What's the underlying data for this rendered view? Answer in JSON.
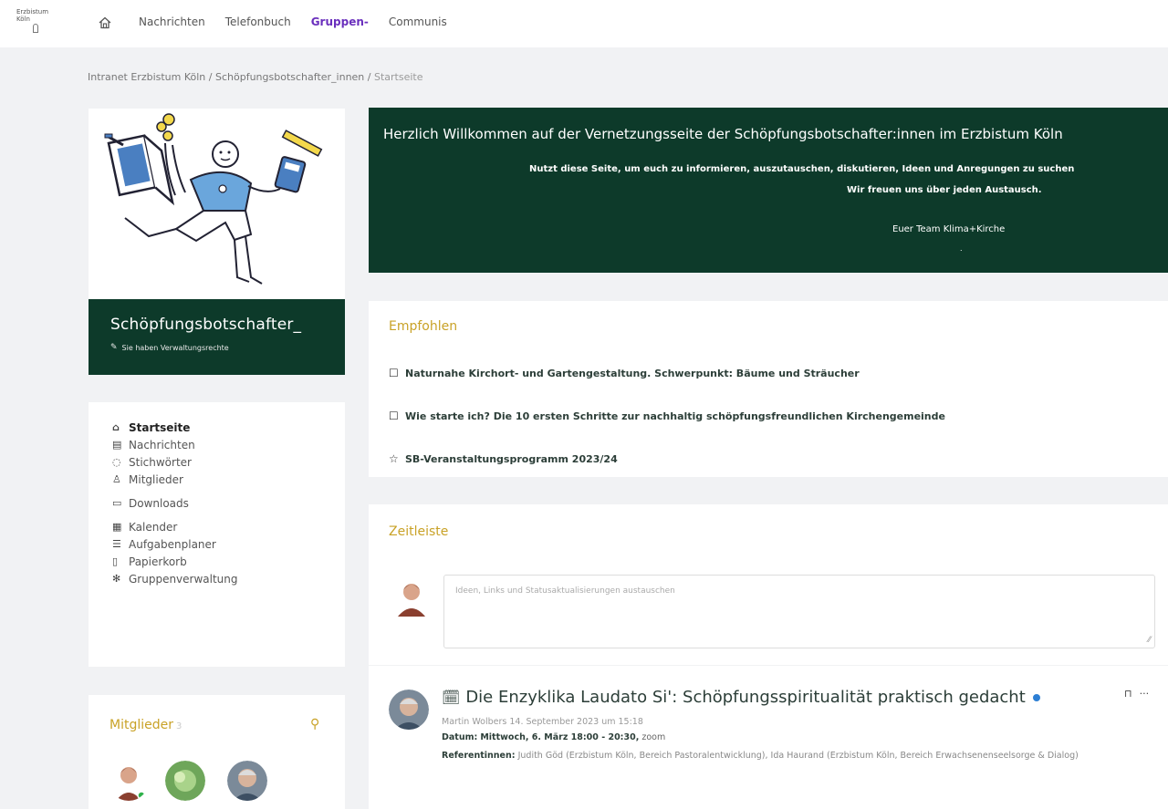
{
  "topbar": {
    "logo_text": "Erzbistum Köln",
    "nav": [
      "Nachrichten",
      "Telefonbuch",
      "Gruppen",
      "Communis"
    ],
    "active_index": 2,
    "active_suffix": "-"
  },
  "breadcrumb": {
    "items": [
      "Intranet Erzbistum Köln",
      "Schöpfungsbotschafter_innen",
      "Startseite"
    ],
    "separator": "/"
  },
  "group": {
    "name": "Schöpfungsbotschafter_",
    "admin_note": "Sie haben Verwaltungsrechte"
  },
  "sidebar": {
    "items": [
      {
        "label": "Startseite",
        "icon": "home-icon",
        "glyph": "⌂"
      },
      {
        "label": "Nachrichten",
        "icon": "news-icon",
        "glyph": "▤"
      },
      {
        "label": "Stichwörter",
        "icon": "tag-icon",
        "glyph": "◌"
      },
      {
        "label": "Mitglieder",
        "icon": "user-icon",
        "glyph": "♙"
      },
      {
        "label": "Downloads",
        "icon": "folder-icon",
        "glyph": "▭"
      },
      {
        "label": "Kalender",
        "icon": "calendar-icon",
        "glyph": "▦"
      },
      {
        "label": "Aufgabenplaner",
        "icon": "tasks-icon",
        "glyph": "☰"
      },
      {
        "label": "Papierkorb",
        "icon": "trash-icon",
        "glyph": "▯"
      },
      {
        "label": "Gruppenverwaltung",
        "icon": "gear-icon",
        "glyph": "✻"
      }
    ]
  },
  "members": {
    "title": "Mitglieder",
    "count": "3",
    "avatars": [
      "member-avatar-1",
      "member-avatar-2",
      "member-avatar-3"
    ]
  },
  "welcome": {
    "heading": "Herzlich Willkommen auf der Vernetzungsseite der Schöpfungsbotschafter:innen im Erzbistum Köln",
    "line1": "Nutzt diese Seite, um euch zu informieren, auszutauschen, diskutieren, Ideen und Anregungen zu suchen",
    "line2": "Wir freuen uns über jeden Austausch.",
    "line3": "Euer Team Klima+Kirche",
    "dot": "."
  },
  "recommended": {
    "title": "Empfohlen",
    "items": [
      {
        "label": "Naturnahe Kirchort- und Gartengestaltung. Schwerpunkt: Bäume und Sträucher",
        "icon": "calendar-icon",
        "glyph": "☐"
      },
      {
        "label": "Wie starte ich? Die 10 ersten Schritte zur nachhaltig schöpfungsfreundlichen Kirchengemeinde",
        "icon": "calendar-icon",
        "glyph": "☐"
      },
      {
        "label": "SB-Veranstaltungsprogramm 2023/24",
        "icon": "star-icon",
        "glyph": "☆"
      }
    ]
  },
  "timeline": {
    "title": "Zeitleiste",
    "placeholder": "Ideen, Links und Statusaktualisierungen austauschen"
  },
  "post": {
    "title": "Die Enzyklika Laudato Si': Schöpfungsspiritualität praktisch gedacht",
    "author_line": "Martin Wolbers 14. September 2023 um 15:18",
    "date_label": "Datum:",
    "date_value": "Mittwoch, 6. März 18:00 - 20:30,",
    "date_suffix": "zoom",
    "speakers_label": "Referentinnen:",
    "speakers_value": "Judith Göd (Erzbistum Köln, Bereich Pastoralentwicklung), Ida Haurand (Erzbistum Köln, Bereich Erwachsenenseelsorge & Dialog)",
    "bookmark_glyph": "⊓",
    "more_glyph": "···"
  }
}
